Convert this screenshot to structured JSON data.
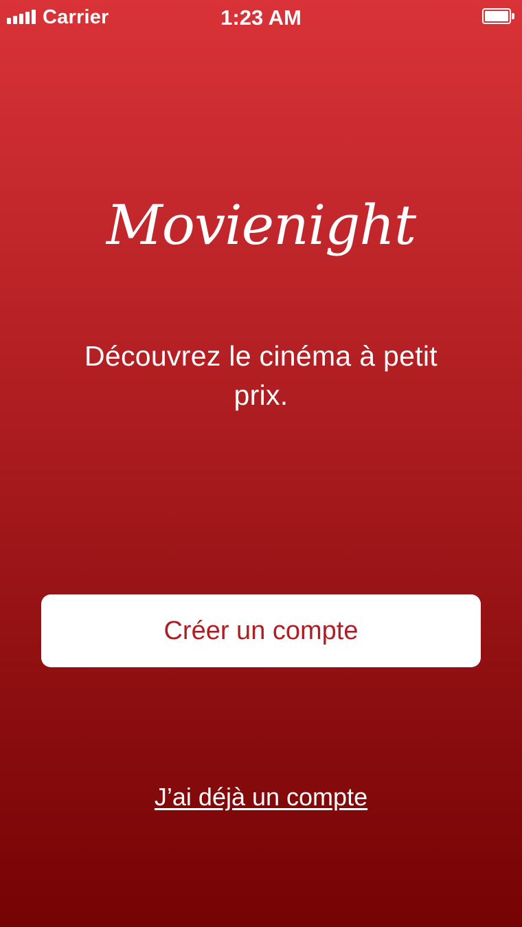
{
  "status_bar": {
    "carrier": "Carrier",
    "time": "1:23 AM",
    "signal_icon": "signal-bars-icon",
    "battery_icon": "battery-icon"
  },
  "app": {
    "logo_text": "Movienight",
    "tagline": "Découvrez le cinéma à petit prix."
  },
  "actions": {
    "create_account_label": "Créer un compte",
    "login_link_label": "J’ai déjà un compte"
  },
  "colors": {
    "background_top": "#d93338",
    "background_bottom": "#760304",
    "button_background": "#ffffff",
    "button_text": "#b01d22",
    "text": "#ffffff"
  }
}
